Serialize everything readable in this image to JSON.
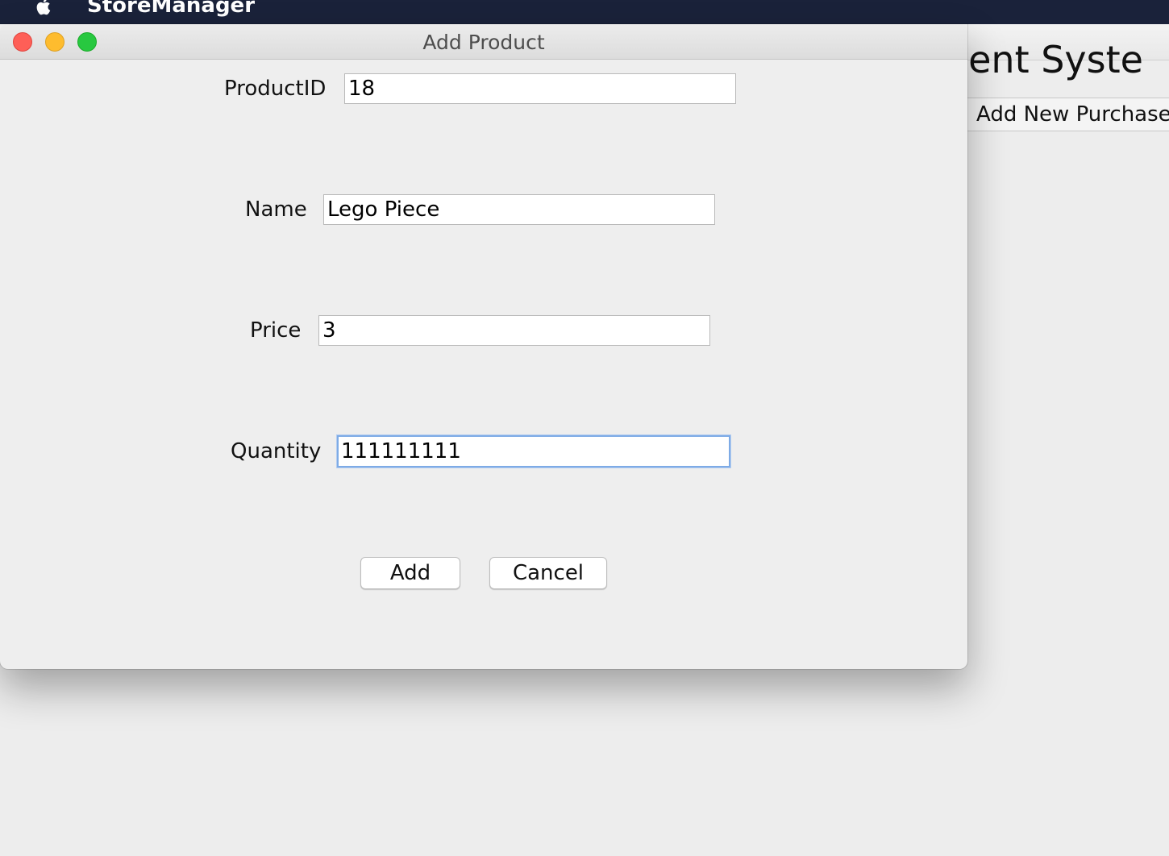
{
  "menubar": {
    "app_name": "StoreManager"
  },
  "background_window": {
    "title_fragment": "ement Syste",
    "tab_label": "Add New Purchase"
  },
  "dialog": {
    "title": "Add Product",
    "fields": [
      {
        "label": "ProductID",
        "value": "18"
      },
      {
        "label": "Name",
        "value": "Lego Piece"
      },
      {
        "label": "Price",
        "value": "3"
      },
      {
        "label": "Quantity",
        "value": "111111111"
      }
    ],
    "buttons": {
      "add_label": "Add",
      "cancel_label": "Cancel"
    }
  },
  "colors": {
    "menubar_bg": "#1a223a",
    "window_bg": "#eeeeee",
    "focus_ring": "#7eabe6",
    "close": "#fe5f57",
    "minimize": "#febc2e",
    "zoom": "#28c840"
  }
}
